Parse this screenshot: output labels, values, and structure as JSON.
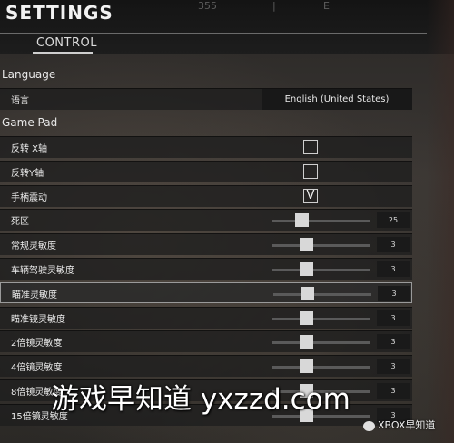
{
  "header": {
    "title": "SETTINGS",
    "tab_control": "CONTROL",
    "faint_texts": [
      "355",
      "|",
      "E"
    ]
  },
  "language": {
    "section": "Language",
    "label": "语言",
    "value": "English (United States)"
  },
  "gamepad": {
    "section": "Game Pad",
    "checkboxes": [
      {
        "label": "反转 X轴",
        "checked": false,
        "mark": ""
      },
      {
        "label": "反转Y轴",
        "checked": false,
        "mark": ""
      },
      {
        "label": "手柄震动",
        "checked": true,
        "mark": "V"
      }
    ],
    "sliders": [
      {
        "label": "死区",
        "value": "25",
        "level": 0.25
      },
      {
        "label": "常规灵敏度",
        "value": "3",
        "level": 0.3
      },
      {
        "label": "车辆驾驶灵敏度",
        "value": "3",
        "level": 0.3
      },
      {
        "label": "瞄准灵敏度",
        "value": "3",
        "level": 0.3
      },
      {
        "label": "瞄准镜灵敏度",
        "value": "3",
        "level": 0.3
      },
      {
        "label": "2倍镜灵敏度",
        "value": "3",
        "level": 0.3
      },
      {
        "label": "4倍镜灵敏度",
        "value": "3",
        "level": 0.3
      },
      {
        "label": "8倍镜灵敏度",
        "value": "3",
        "level": 0.3
      },
      {
        "label": "15倍镜灵敏度",
        "value": "3",
        "level": 0.3
      }
    ]
  },
  "watermark": {
    "main": "游戏早知道 yxzzd.com",
    "sub": "XBOX早知道"
  },
  "colors": {
    "row_bg": "#1e1e1e",
    "knob": "#d8d8d8",
    "track": "#5a5a5a"
  }
}
